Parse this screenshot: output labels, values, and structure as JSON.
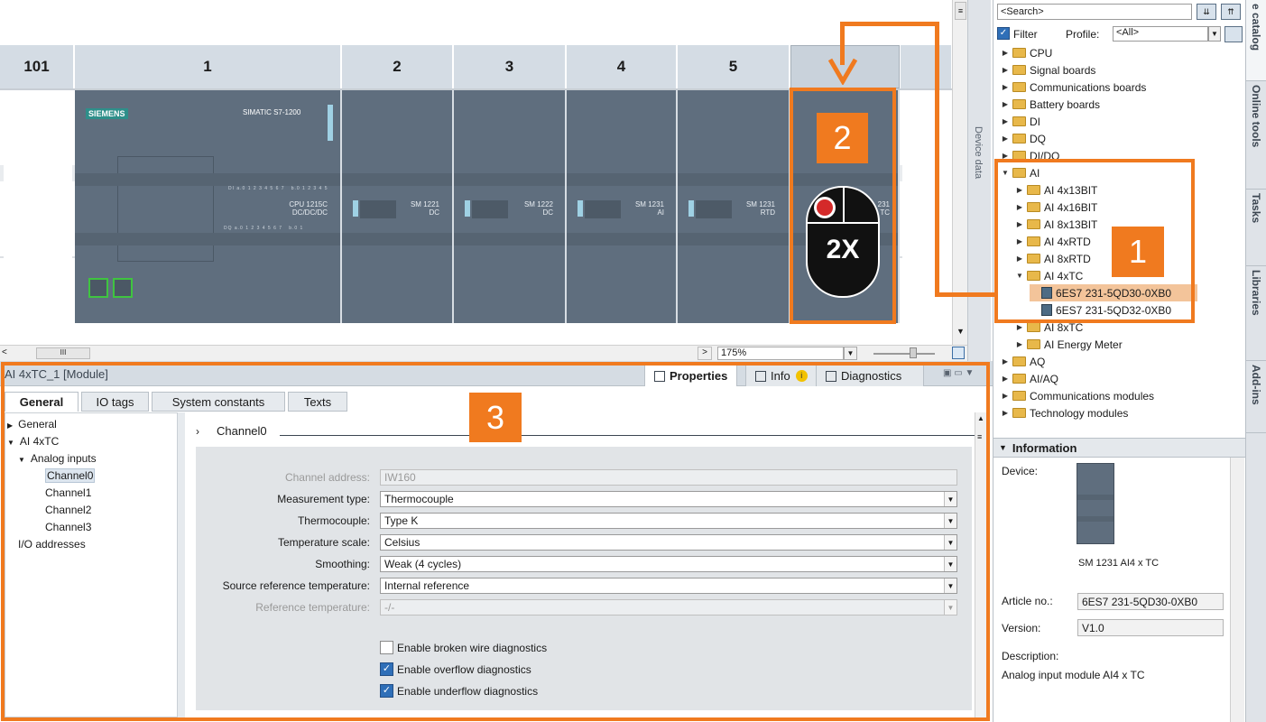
{
  "slots": [
    "101",
    "1",
    "2",
    "3",
    "4",
    "5"
  ],
  "modules": {
    "cpu": {
      "brand": "SIEMENS",
      "model": "SIMATIC S7-1200",
      "type_line1": "CPU 1215C",
      "type_line2": "DC/DC/DC"
    },
    "sm1221": {
      "line1": "SM 1221",
      "line2": "DC"
    },
    "sm1222": {
      "line1": "SM 1222",
      "line2": "DC"
    },
    "sm1231ai": {
      "line1": "SM 1231",
      "line2": "AI"
    },
    "sm1231rtd": {
      "line1": "SM 1231",
      "line2": "RTD"
    },
    "new_module": {
      "line1": "231",
      "line2": "TC"
    }
  },
  "overlay": {
    "callout1": "1",
    "callout2": "2",
    "callout3": "3",
    "double_click": "2X"
  },
  "device_area": {
    "zoom": "175%",
    "device_data_tab": "Device data"
  },
  "catalog": {
    "search_placeholder": "<Search>",
    "filter_label": "Filter",
    "profile_label": "Profile:",
    "profile_value": "<All>",
    "items": [
      {
        "label": "CPU",
        "level": 0,
        "expanded": false
      },
      {
        "label": "Signal boards",
        "level": 0,
        "expanded": false
      },
      {
        "label": "Communications boards",
        "level": 0,
        "expanded": false
      },
      {
        "label": "Battery boards",
        "level": 0,
        "expanded": false
      },
      {
        "label": "DI",
        "level": 0,
        "expanded": false
      },
      {
        "label": "DQ",
        "level": 0,
        "expanded": false
      },
      {
        "label": "DI/DQ",
        "level": 0,
        "expanded": false
      },
      {
        "label": "AI",
        "level": 0,
        "expanded": true
      },
      {
        "label": "AI 4x13BIT",
        "level": 1,
        "expanded": false
      },
      {
        "label": "AI 4x16BIT",
        "level": 1,
        "expanded": false
      },
      {
        "label": "AI 8x13BIT",
        "level": 1,
        "expanded": false
      },
      {
        "label": "AI 4xRTD",
        "level": 1,
        "expanded": false
      },
      {
        "label": "AI 8xRTD",
        "level": 1,
        "expanded": false
      },
      {
        "label": "AI 4xTC",
        "level": 1,
        "expanded": true
      },
      {
        "label": "6ES7 231-5QD30-0XB0",
        "level": 2,
        "selected": true
      },
      {
        "label": "6ES7 231-5QD32-0XB0",
        "level": 2,
        "selected": false
      },
      {
        "label": "AI 8xTC",
        "level": 1,
        "expanded": false
      },
      {
        "label": "AI Energy Meter",
        "level": 1,
        "expanded": false
      },
      {
        "label": "AQ",
        "level": 0,
        "expanded": false
      },
      {
        "label": "AI/AQ",
        "level": 0,
        "expanded": false
      },
      {
        "label": "Communications modules",
        "level": 0,
        "expanded": false
      },
      {
        "label": "Technology modules",
        "level": 0,
        "expanded": false
      }
    ]
  },
  "information": {
    "header": "Information",
    "device_label": "Device:",
    "device_name": "SM 1231 AI4 x TC",
    "article_label": "Article no.:",
    "article_value": "6ES7 231-5QD30-0XB0",
    "version_label": "Version:",
    "version_value": "V1.0",
    "description_label": "Description:",
    "description_value": "Analog input module AI4 x TC"
  },
  "side_tabs": [
    "e catalog",
    "Online tools",
    "Tasks",
    "Libraries",
    "Add-ins"
  ],
  "properties": {
    "title": "AI 4xTC_1 [Module]",
    "tabs": [
      "Properties",
      "Info",
      "Diagnostics"
    ],
    "subtabs": [
      "General",
      "IO tags",
      "System constants",
      "Texts"
    ],
    "nav": [
      {
        "label": "General",
        "level": 0
      },
      {
        "label": "AI 4xTC",
        "level": 0
      },
      {
        "label": "Analog inputs",
        "level": 1
      },
      {
        "label": "Channel0",
        "level": 2,
        "selected": true
      },
      {
        "label": "Channel1",
        "level": 2
      },
      {
        "label": "Channel2",
        "level": 2
      },
      {
        "label": "Channel3",
        "level": 2
      },
      {
        "label": "I/O addresses",
        "level": 1
      }
    ],
    "section_title": "Channel0",
    "fields": [
      {
        "label": "Channel address:",
        "value": "IW160",
        "disabled": true,
        "dropdown": false
      },
      {
        "label": "Measurement type:",
        "value": "Thermocouple",
        "disabled": false,
        "dropdown": true
      },
      {
        "label": "Thermocouple:",
        "value": "Type K",
        "disabled": false,
        "dropdown": true
      },
      {
        "label": "Temperature scale:",
        "value": "Celsius",
        "disabled": false,
        "dropdown": true
      },
      {
        "label": "Smoothing:",
        "value": "Weak (4 cycles)",
        "disabled": false,
        "dropdown": true
      },
      {
        "label": "Source reference temperature:",
        "value": "Internal reference",
        "disabled": false,
        "dropdown": true
      },
      {
        "label": "Reference temperature:",
        "value": "-/-",
        "disabled": true,
        "dropdown": true
      }
    ],
    "checkboxes": [
      {
        "label": "Enable broken wire diagnostics",
        "checked": false
      },
      {
        "label": "Enable overflow diagnostics",
        "checked": true
      },
      {
        "label": "Enable underflow diagnostics",
        "checked": true
      }
    ]
  },
  "colors": {
    "highlight": "#f07a1f",
    "module": "#5f6e7e",
    "selected_row": "#f3c49a"
  }
}
